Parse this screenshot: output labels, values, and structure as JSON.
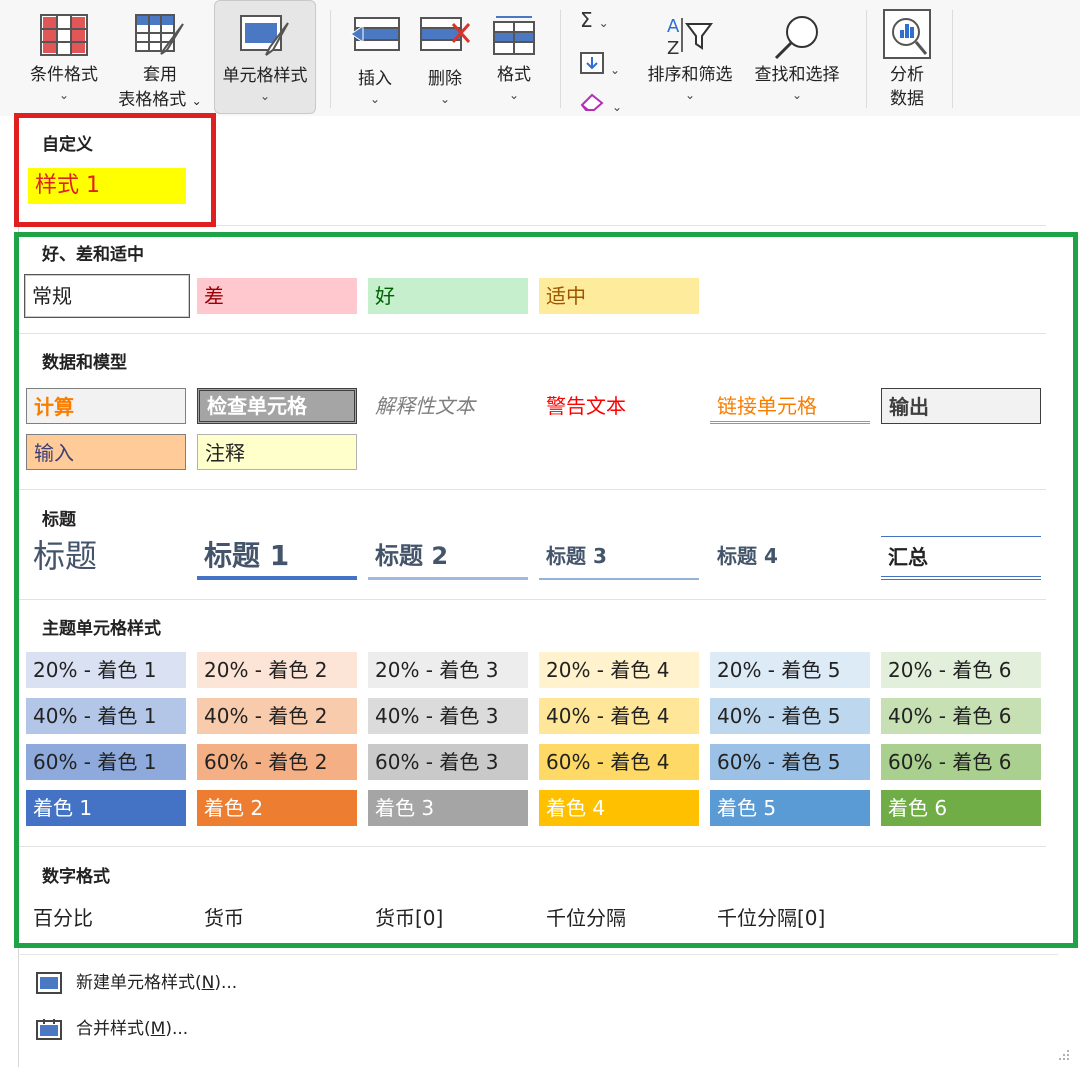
{
  "ribbon": {
    "conditional_format": "条件格式",
    "table_format_l1": "套用",
    "table_format_l2": "表格格式",
    "cell_styles": "单元格样式",
    "insert": "插入",
    "delete": "删除",
    "format": "格式",
    "sort_filter": "排序和筛选",
    "find_select": "查找和选择",
    "analyze_l1": "分析",
    "analyze_l2": "数据",
    "sigma": "Σ",
    "chevron": "⌄"
  },
  "custom": {
    "title": "自定义",
    "style1": "样式 1"
  },
  "good_bad": {
    "title": "好、差和适中",
    "items": [
      "常规",
      "差",
      "好",
      "适中"
    ]
  },
  "data_model": {
    "title": "数据和模型",
    "items": [
      "计算",
      "检查单元格",
      "解释性文本",
      "警告文本",
      "链接单元格",
      "输出",
      "输入",
      "注释"
    ]
  },
  "titles": {
    "title": "标题",
    "items": [
      "标题",
      "标题 1",
      "标题 2",
      "标题 3",
      "标题 4",
      "汇总"
    ]
  },
  "theme": {
    "title": "主题单元格样式",
    "row20": [
      "20% - 着色 1",
      "20% - 着色 2",
      "20% - 着色 3",
      "20% - 着色 4",
      "20% - 着色 5",
      "20% - 着色 6"
    ],
    "row40": [
      "40% - 着色 1",
      "40% - 着色 2",
      "40% - 着色 3",
      "40% - 着色 4",
      "40% - 着色 5",
      "40% - 着色 6"
    ],
    "row60": [
      "60% - 着色 1",
      "60% - 着色 2",
      "60% - 着色 3",
      "60% - 着色 4",
      "60% - 着色 5",
      "60% - 着色 6"
    ],
    "row100": [
      "着色 1",
      "着色 2",
      "着色 3",
      "着色 4",
      "着色 5",
      "着色 6"
    ]
  },
  "number": {
    "title": "数字格式",
    "items": [
      "百分比",
      "货币",
      "货币[0]",
      "千位分隔",
      "千位分隔[0]"
    ]
  },
  "menu": {
    "new_style_text": "新建单元格样式(",
    "new_style_key": "N",
    "new_style_end": ")...",
    "merge_text": "合并样式(",
    "merge_key": "M",
    "merge_end": ")..."
  },
  "colors": {
    "highlight_red": "#e02020",
    "highlight_green": "#1fa347",
    "accent1": "#4472c4",
    "accent2": "#ed7d31",
    "accent3": "#a5a5a5",
    "accent4": "#ffc000",
    "accent5": "#5b9bd5",
    "accent6": "#70ad47"
  }
}
